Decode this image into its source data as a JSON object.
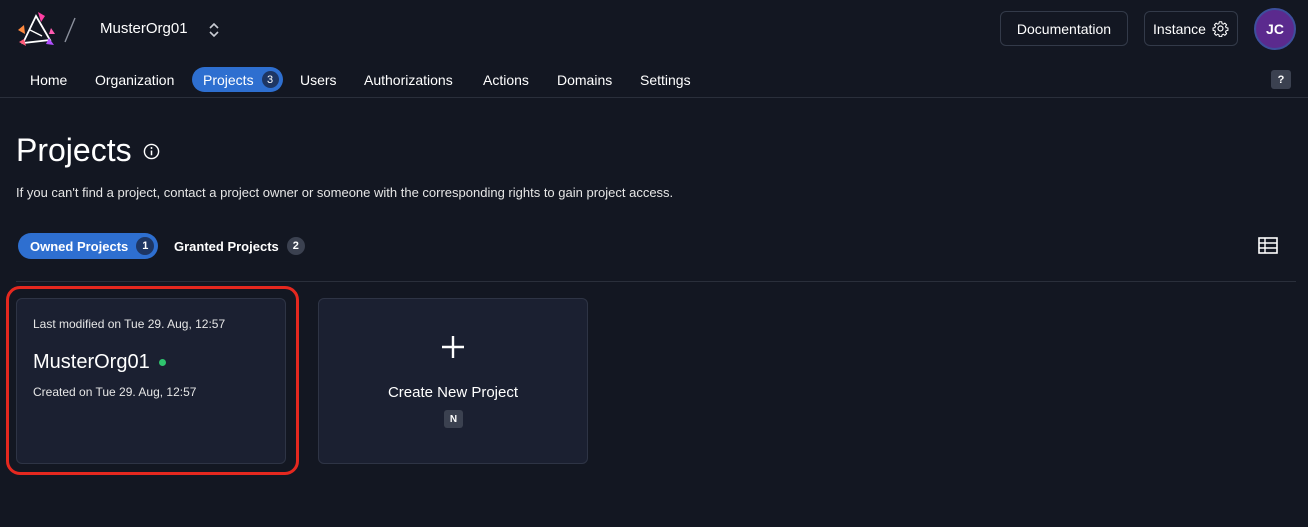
{
  "header": {
    "org_name": "MusterOrg01",
    "documentation_label": "Documentation",
    "instance_label": "Instance",
    "avatar_initials": "JC"
  },
  "nav": {
    "items": [
      {
        "label": "Home"
      },
      {
        "label": "Organization"
      },
      {
        "label": "Projects",
        "count": "3",
        "active": true
      },
      {
        "label": "Users"
      },
      {
        "label": "Authorizations"
      },
      {
        "label": "Actions"
      },
      {
        "label": "Domains"
      },
      {
        "label": "Settings"
      }
    ],
    "help_label": "?"
  },
  "page": {
    "title": "Projects",
    "description": "If you can't find a project, contact a project owner or someone with the corresponding rights to gain project access."
  },
  "tabs": {
    "owned": {
      "label": "Owned Projects",
      "count": "1",
      "active": true
    },
    "granted": {
      "label": "Granted Projects",
      "count": "2"
    }
  },
  "projects": [
    {
      "last_modified": "Last modified on Tue 29. Aug, 12:57",
      "name": "MusterOrg01",
      "created": "Created on Tue 29. Aug, 12:57",
      "status_color": "#2fc46e"
    }
  ],
  "create_card": {
    "label": "Create New Project",
    "shortcut": "N"
  },
  "colors": {
    "background": "#131722",
    "accent": "#2e6fd0",
    "card": "#1b2031",
    "highlight": "#e5281f"
  }
}
